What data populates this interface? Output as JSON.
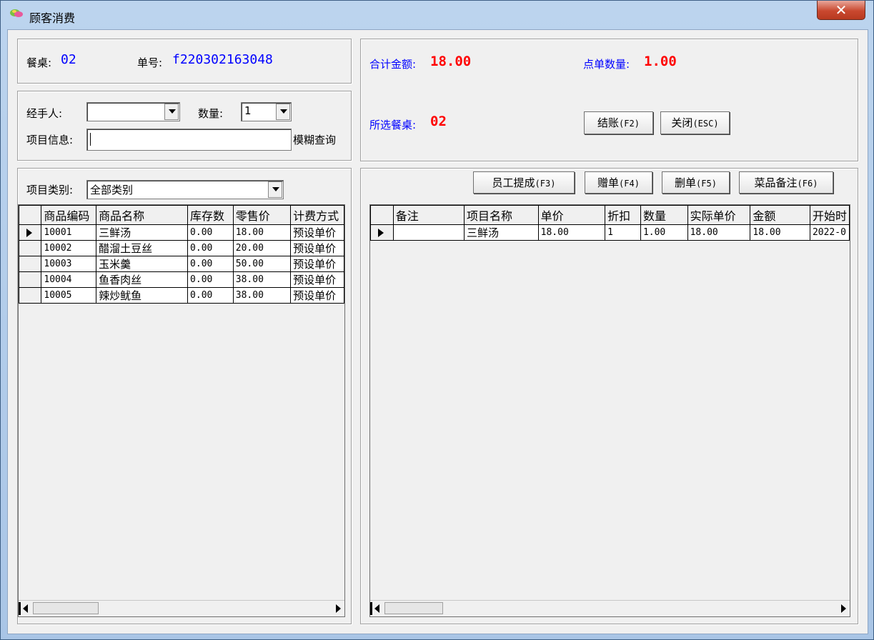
{
  "window": {
    "title": "顾客消费",
    "close_glyph": "✕"
  },
  "order": {
    "table_label": "餐桌:",
    "table_value": "02",
    "order_no_label": "单号:",
    "order_no_value": "f220302163048"
  },
  "filters": {
    "handler_label": "经手人:",
    "handler_value": "",
    "qty_label": "数量:",
    "qty_value": "1",
    "item_info_label": "项目信息:",
    "item_info_value": "",
    "fuzzy_label": "模糊查询",
    "category_label": "项目类别:",
    "category_value": "全部类别"
  },
  "summary": {
    "total_label": "合计金额:",
    "total_value": "18.00",
    "count_label": "点单数量:",
    "count_value": "1.00",
    "selected_table_label": "所选餐桌:",
    "selected_table_value": "02"
  },
  "buttons": {
    "checkout": "结账",
    "checkout_key": "(F2)",
    "close": "关闭",
    "close_key": "(ESC)",
    "commission": "员工提成",
    "commission_key": "(F3)",
    "gift": "赠单",
    "gift_key": "(F4)",
    "delete": "删单",
    "delete_key": "(F5)",
    "remark": "菜品备注",
    "remark_key": "(F6)"
  },
  "products": {
    "columns": [
      "商品编码",
      "商品名称",
      "库存数",
      "零售价",
      "计费方式"
    ],
    "rows": [
      [
        "10001",
        "三鲜汤",
        "0.00",
        "18.00",
        "预设单价"
      ],
      [
        "10002",
        "醋溜土豆丝",
        "0.00",
        "20.00",
        "预设单价"
      ],
      [
        "10003",
        "玉米羹",
        "0.00",
        "50.00",
        "预设单价"
      ],
      [
        "10004",
        "鱼香肉丝",
        "0.00",
        "38.00",
        "预设单价"
      ],
      [
        "10005",
        "辣炒鱿鱼",
        "0.00",
        "38.00",
        "预设单价"
      ]
    ]
  },
  "order_items": {
    "columns": [
      "备注",
      "项目名称",
      "单价",
      "折扣",
      "数量",
      "实际单价",
      "金额",
      "开始时"
    ],
    "rows": [
      [
        "",
        "三鲜汤",
        "18.00",
        "1",
        "1.00",
        "18.00",
        "18.00",
        "2022-0"
      ]
    ]
  },
  "colors": {
    "label_blue": "#0000ff",
    "value_red": "#ff0000",
    "titlebar": "#bcd4ee",
    "close_red": "#c9482f"
  }
}
